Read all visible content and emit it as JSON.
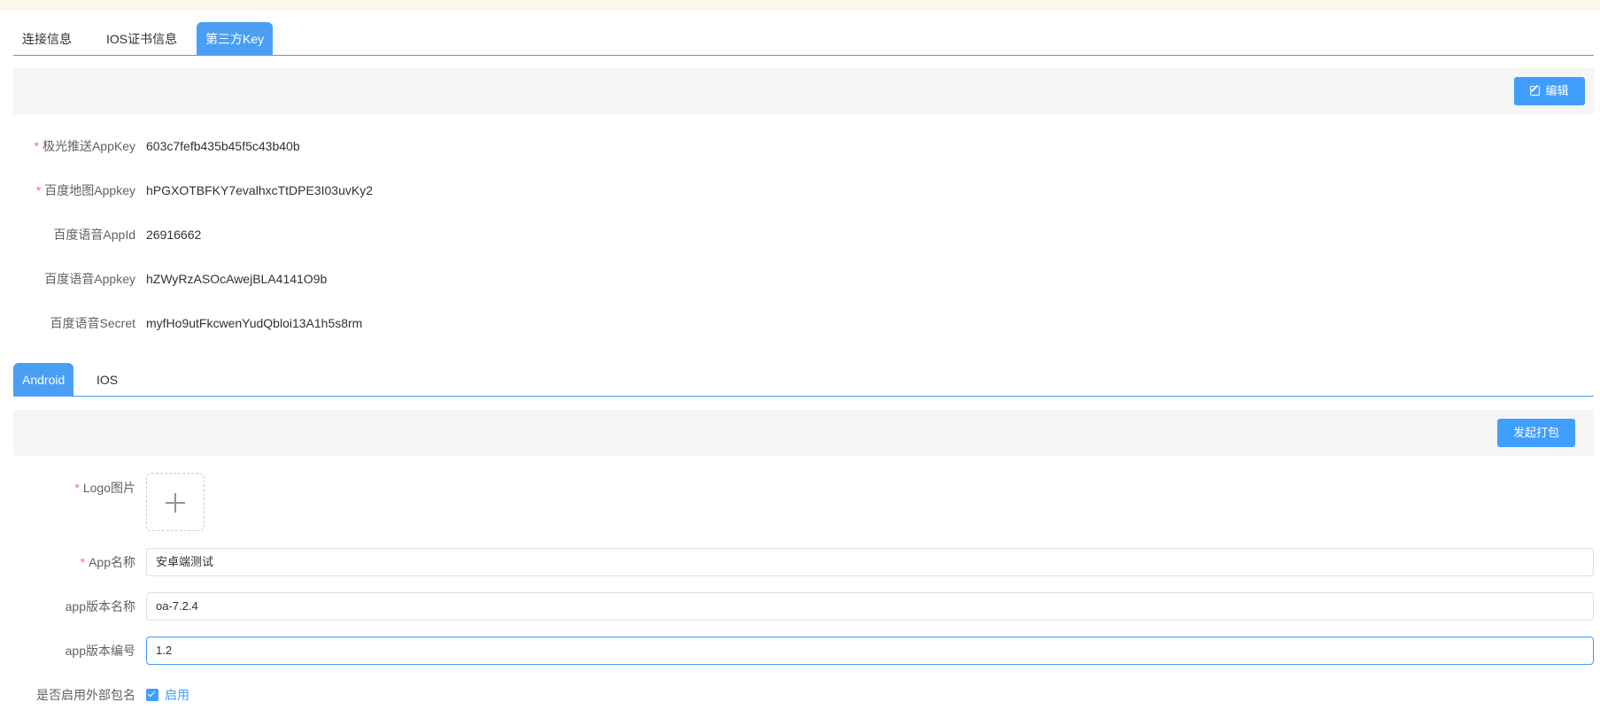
{
  "top_tabs": [
    "连接信息",
    "IOS证书信息",
    "第三方Key"
  ],
  "edit_button": "编辑",
  "keys": [
    {
      "label": "极光推送AppKey",
      "required": true,
      "value": "603c7fefb435b45f5c43b40b"
    },
    {
      "label": "百度地图Appkey",
      "required": true,
      "value": "hPGXOTBFKY7evalhxcTtDPE3I03uvKy2"
    },
    {
      "label": "百度语音AppId",
      "required": false,
      "value": "26916662"
    },
    {
      "label": "百度语音Appkey",
      "required": false,
      "value": "hZWyRzASOcAwejBLA4141O9b"
    },
    {
      "label": "百度语音Secret",
      "required": false,
      "value": "myfHo9utFkcwenYudQbloi13A1h5s8rm"
    }
  ],
  "platform_tabs": [
    "Android",
    "IOS"
  ],
  "build_button": "发起打包",
  "form": {
    "logo_label": "Logo图片",
    "app_name_label": "App名称",
    "app_name_value": "安卓端测试",
    "version_name_label": "app版本名称",
    "version_name_value": "oa-7.2.4",
    "version_code_label": "app版本编号",
    "version_code_value": "1.2",
    "external_pkg_label": "是否启用外部包名",
    "external_pkg_option": "启用"
  },
  "colors": {
    "primary": "#409eff",
    "required": "#f56c6c",
    "band": "#f5f5f5"
  }
}
